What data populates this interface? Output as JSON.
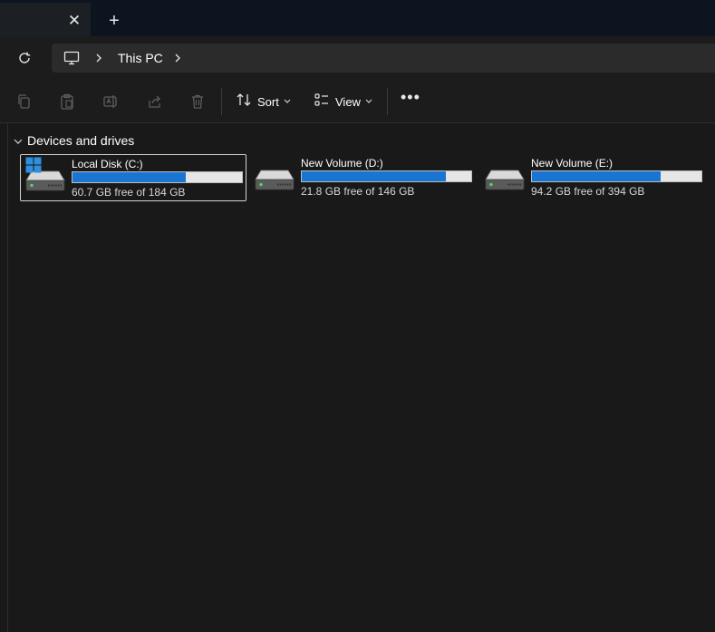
{
  "tabs": {
    "close_glyph": "✕",
    "new_tab_glyph": "+"
  },
  "address": {
    "location": "This PC",
    "icons": [
      "refresh-icon",
      "computer-icon",
      "chevron-right-icon"
    ]
  },
  "toolbar": {
    "icons": [
      "copy-icon",
      "paste-icon",
      "rename-icon",
      "share-icon",
      "delete-icon"
    ],
    "sort_label": "Sort",
    "view_label": "View",
    "more_glyph": "•••"
  },
  "section": {
    "title": "Devices and drives"
  },
  "drives": [
    {
      "name": "Local Disk (C:)",
      "free_text": "60.7 GB free of 184 GB",
      "used_fraction": 0.67,
      "selected": true,
      "system": true
    },
    {
      "name": "New Volume (D:)",
      "free_text": "21.8 GB free of 146 GB",
      "used_fraction": 0.85,
      "selected": false,
      "system": false
    },
    {
      "name": "New Volume (E:)",
      "free_text": "94.2 GB free of 394 GB",
      "used_fraction": 0.76,
      "selected": false,
      "system": false
    }
  ],
  "colors": {
    "accent": "#1a75d2",
    "background": "#191919",
    "bar_track": "#e6e6e6"
  }
}
